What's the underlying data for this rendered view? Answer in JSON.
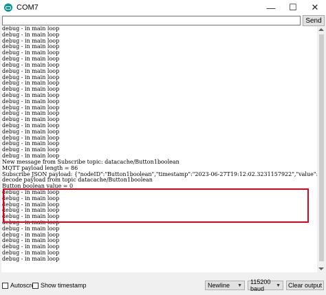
{
  "window": {
    "title": "COM7",
    "minimize": "—",
    "maximize": "☐",
    "close": "✕"
  },
  "send": {
    "input_value": "",
    "button_label": "Send"
  },
  "output_lines_before": [
    "debug - in main loop",
    "debug - in main loop",
    "debug - in main loop",
    "debug - in main loop",
    "debug - in main loop",
    "debug - in main loop",
    "debug - in main loop",
    "debug - in main loop",
    "debug - in main loop",
    "debug - in main loop",
    "debug - in main loop",
    "debug - in main loop",
    "debug - in main loop",
    "debug - in main loop",
    "debug - in main loop",
    "debug - in main loop",
    "debug - in main loop",
    "debug - in main loop",
    "debug - in main loop",
    "debug - in main loop",
    "debug - in main loop",
    "debug - in main loop"
  ],
  "highlighted_lines": [
    "New message from Subscribe topic: datacache/Button1boolean",
    "MQTT payload length = 86",
    "Subscribe JSON payload: {\"nodeID\":\"Button1boolean\",\"timestamp\":\"2023-06-27T19:12:02.3231157922\",\"value\":false}",
    "decode payload from topic datacache/Button1boolean",
    "Button boolean value = 0"
  ],
  "output_lines_after": [
    "debug - in main loop",
    "debug - in main loop",
    "debug - in main loop",
    "debug - in main loop",
    "debug - in main loop",
    "debug - in main loop",
    "debug - in main loop",
    "debug - in main loop",
    "debug - in main loop",
    "debug - in main loop",
    "debug - in main loop",
    "debug - in main loop"
  ],
  "bottom": {
    "autoscroll_label": "Autoscroll",
    "timestamp_label": "Show timestamp",
    "line_ending": "Newline",
    "baud": "115200 baud",
    "clear_label": "Clear output"
  },
  "colors": {
    "highlight_border": "#e0001a",
    "app_icon": "#00979d"
  }
}
